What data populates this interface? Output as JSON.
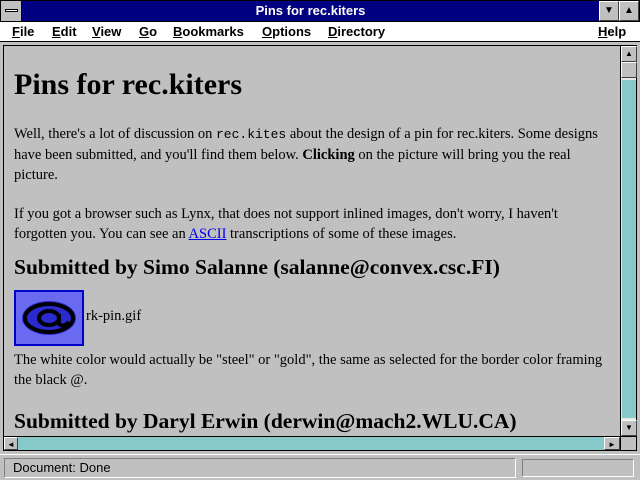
{
  "window": {
    "title": "Pins for rec.kiters",
    "minimize_glyph": "▼",
    "maximize_glyph": "▲"
  },
  "menu": {
    "items": [
      {
        "label_first": "F",
        "label_rest": "ile"
      },
      {
        "label_first": "E",
        "label_rest": "dit"
      },
      {
        "label_first": "V",
        "label_rest": "iew"
      },
      {
        "label_first": "G",
        "label_rest": "o"
      },
      {
        "label_first": "B",
        "label_rest": "ookmarks"
      },
      {
        "label_first": "O",
        "label_rest": "ptions"
      },
      {
        "label_first": "D",
        "label_rest": "irectory"
      },
      {
        "label_first": "H",
        "label_rest": "elp"
      }
    ]
  },
  "page": {
    "heading": "Pins for rec.kiters",
    "intro": {
      "part1": "Well, there's a lot of discussion on ",
      "code": "rec.kites",
      "part2": " about the design of a pin for rec.kiters. Some designs have been submitted, and you'll find them below. ",
      "bold": "Clicking",
      "part3": " on the picture will bring you the real picture."
    },
    "lynx": {
      "part1": "If you got a browser such as Lynx, that does not support inlined images, don't worry, I haven't forgotten you. You can see an ",
      "link": "ASCII",
      "part2": " transcriptions of some of these images."
    },
    "section1": {
      "heading": "Submitted by Simo Salanne (salanne@convex.csc.FI)",
      "image_label": "rk-pin.gif",
      "image_glyph": "@",
      "note": "The white color would actually be \"steel\" or \"gold\", the same as selected for the border color framing the black @."
    },
    "section2": {
      "heading": "Submitted by Daryl Erwin (derwin@mach2.WLU.CA)"
    }
  },
  "scroll": {
    "up_glyph": "▲",
    "down_glyph": "▼",
    "left_glyph": "◄",
    "right_glyph": "►"
  },
  "status": {
    "text": "Document: Done"
  },
  "colors": {
    "titlebar": "#000080",
    "link": "#0000ee",
    "scroll_track": "#87c8c8",
    "pin_background": "#6a6af0"
  }
}
